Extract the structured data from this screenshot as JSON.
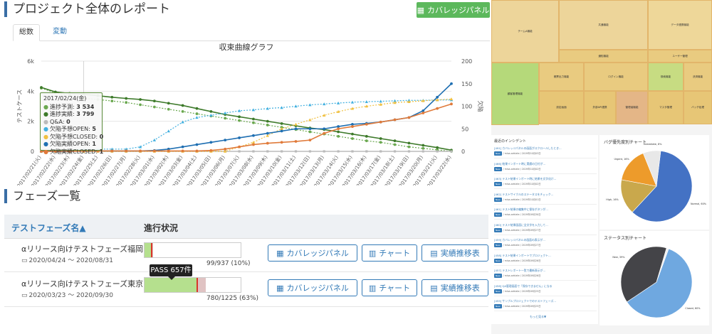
{
  "header": {
    "title": "プロジェクト全体のレポート",
    "coverage_button": "カバレッジパネル"
  },
  "tabs": [
    {
      "label": "総数",
      "active": true
    },
    {
      "label": "変動",
      "active": false
    }
  ],
  "chart_data": {
    "type": "line",
    "title": "収束曲線グラフ",
    "ylabel": "テストケース",
    "y2label": "欠陥",
    "ylim": [
      0,
      6000
    ],
    "y2lim": [
      0,
      200
    ],
    "yticks": [
      "0",
      "2k",
      "4k",
      "6k"
    ],
    "y2ticks": [
      "0",
      "50",
      "100",
      "150",
      "200"
    ],
    "x": [
      "2017/02/21(火)",
      "2017/02/22(水)",
      "2017/02/23(木)",
      "2017/02/24(金)",
      "2017/02/25(土)",
      "2017/02/26(日)",
      "2017/02/27(月)",
      "2017/02/28(火)",
      "2017/03/01(水)",
      "2017/03/02(木)",
      "2017/03/03(金)",
      "2017/03/04(土)",
      "2017/03/05(日)",
      "2017/03/06(月)",
      "2017/03/07(火)",
      "2017/03/08(水)",
      "2017/03/09(木)",
      "2017/03/10(金)",
      "2017/03/11(土)",
      "2017/03/12(日)",
      "2017/03/13(月)",
      "2017/03/14(火)",
      "2017/03/15(水)",
      "2017/03/16(木)",
      "2017/03/17(金)",
      "2017/03/18(土)",
      "2017/03/19(日)",
      "2017/03/20(月)",
      "2017/03/21(火)",
      "2017/03/22(水)"
    ],
    "series": [
      {
        "name": "進捗予測",
        "axis": "left",
        "color": "#6aa84f",
        "dash": "2,2",
        "marker": "circle",
        "values": [
          4200,
          3900,
          3700,
          3534,
          3450,
          3350,
          3250,
          3100,
          2950,
          2800,
          2650,
          2500,
          2350,
          2200,
          2050,
          1900,
          1750,
          1600,
          1450,
          1300,
          1150,
          1000,
          850,
          700,
          600,
          450,
          300,
          200,
          100,
          0
        ]
      },
      {
        "name": "進捗実績",
        "axis": "left",
        "color": "#3d7a2a",
        "dash": "",
        "marker": "circle",
        "values": [
          4250,
          3950,
          3850,
          3799,
          3700,
          3600,
          3520,
          3450,
          3350,
          3200,
          3050,
          2850,
          2650,
          2450,
          2300,
          2150,
          2000,
          1850,
          1700,
          1550,
          1450,
          1300,
          1150,
          1000,
          850,
          700,
          550,
          400,
          250,
          80
        ]
      },
      {
        "name": "Q&A",
        "axis": "right",
        "color": "#bbbbbb",
        "dash": "",
        "marker": "square",
        "values": [
          0,
          0,
          0,
          0,
          0,
          0,
          0,
          0,
          0,
          0,
          0,
          0,
          0,
          0,
          0,
          0,
          0,
          0,
          0,
          0,
          0,
          0,
          0,
          0,
          0,
          0,
          0,
          0,
          0,
          0
        ]
      },
      {
        "name": "欠陥予想OPEN",
        "axis": "right",
        "color": "#42b0e0",
        "dash": "2,2",
        "marker": "triangle",
        "values": [
          0,
          0,
          0,
          5,
          5,
          5,
          5,
          10,
          25,
          45,
          65,
          75,
          80,
          85,
          90,
          92,
          95,
          97,
          100,
          103,
          105,
          107,
          109,
          110,
          111,
          112,
          113,
          113,
          114,
          114
        ]
      },
      {
        "name": "欠陥予想CLOSED",
        "axis": "right",
        "color": "#f0c040",
        "dash": "2,2",
        "marker": "triangle",
        "values": [
          0,
          0,
          0,
          0,
          0,
          0,
          0,
          0,
          0,
          0,
          0,
          0,
          0,
          0,
          10,
          20,
          35,
          50,
          60,
          70,
          80,
          88,
          95,
          100,
          104,
          108,
          110,
          112,
          114,
          116
        ]
      },
      {
        "name": "欠陥実績OPEN",
        "axis": "right",
        "color": "#1f6fb2",
        "dash": "",
        "marker": "circle",
        "values": [
          0,
          0,
          0,
          1,
          1,
          1,
          1,
          1,
          2,
          5,
          10,
          15,
          20,
          25,
          30,
          35,
          40,
          45,
          50,
          50,
          50,
          55,
          60,
          62,
          65,
          70,
          75,
          90,
          120,
          150
        ]
      },
      {
        "name": "欠陥実績CLOSED",
        "axis": "right",
        "color": "#e07a3a",
        "dash": "",
        "marker": "circle",
        "values": [
          0,
          0,
          0,
          1,
          1,
          1,
          1,
          1,
          1,
          1,
          1,
          1,
          2,
          5,
          10,
          15,
          18,
          20,
          22,
          25,
          40,
          50,
          55,
          60,
          65,
          70,
          75,
          85,
          95,
          105
        ]
      }
    ],
    "tooltip": {
      "date": "2017/02/24(金)",
      "rows": [
        {
          "name": "進捗予測",
          "value": "3 534"
        },
        {
          "name": "進捗実績",
          "value": "3 799"
        },
        {
          "name": "Q&A",
          "value": "0"
        },
        {
          "name": "欠陥予想OPEN",
          "value": "5"
        },
        {
          "name": "欠陥予想CLOSED",
          "value": "0"
        },
        {
          "name": "欠陥実績OPEN",
          "value": "1"
        },
        {
          "name": "欠陥実績CLOSED",
          "value": "1"
        }
      ]
    }
  },
  "phases": {
    "title": "フェーズ一覧",
    "col_name": "テストフェーズ名▲",
    "col_progress": "進行状況",
    "rows": [
      {
        "name": "αリリース向けテストフェーズ福岡",
        "date": "2020/04/24 〜 2020/08/31",
        "count": "99/937 (10%)",
        "pass_fraction": 0.07,
        "fail_fraction": 0.02
      },
      {
        "name": "αリリース向けテストフェーズ東京",
        "date": "2020/03/23 〜 2020/09/30",
        "count": "780/1225 (63%)",
        "pass_fraction": 0.54,
        "fail_fraction": 0.1
      }
    ],
    "pass_tip": "PASS 657件",
    "buttons": {
      "coverage": "カバレッジパネル",
      "chart": "チャート",
      "history": "実績推移表"
    }
  },
  "treemap": {
    "cells": [
      "チームA機能",
      "共通機能",
      "データ連携機能",
      "顧客管理機能",
      "帳票出力機能",
      "ログイン機能",
      "検索機能",
      "決済機能",
      "通知機能",
      "ユーザー管理",
      "設定画面",
      "外部API連携",
      "管理者機能",
      "マスタ管理",
      "バッチ処理",
      "セキュリティ",
      "レポート機能"
    ]
  },
  "incidents": {
    "title": "最近のインシデント",
    "more": "もっと見る▼",
    "items": [
      {
        "text": "[491] カバレッジパネルの画面がスクロールしたとき…",
        "meta": "/ misa-sekiate / 2019年10月03日"
      },
      {
        "text": "[466] 結果インポート時に実績の日付が…",
        "meta": "/ misa-sekiate / 2019年10月02日"
      },
      {
        "text": "[463] テスト結果インポート時に結果を文字化け…",
        "meta": "/ misa-sekiate / 2019年10月02日"
      },
      {
        "text": "[462] テストサイクルのステータスをチェック…",
        "meta": "/ misa-sekiate / 2019年10月01日"
      },
      {
        "text": "[461] テスト結果の編集中に保存ボタンが…",
        "meta": "/ misa-sekiate / 2019年09月30日"
      },
      {
        "text": "[460] テスト結果画面に全文字を入力して…",
        "meta": "/ misa-sekiate / 2019年09月27日"
      },
      {
        "text": "[459] カバレッジパネルの画面の表示が…",
        "meta": "/ misa-sekiate / 2019年09月27日"
      },
      {
        "text": "[458] テスト結果インポートでプロジェクト…",
        "meta": "/ misa-sekiate / 2019年09月26日"
      },
      {
        "text": "[457] テストレポート一覧で最新表示が…",
        "meta": "/ misa-sekiate / 2019年09月26日"
      },
      {
        "text": "[456] QA管理画面で「保存できません」になる",
        "meta": "/ misa-sekiate / 2019年09月25日"
      },
      {
        "text": "[455] サンプルプロジェクトでのテストフェーズ…",
        "meta": "/ misa-sekiate / 2019年09月25日"
      }
    ]
  },
  "pies": [
    {
      "title": "バグ優先度別チャート",
      "slices": [
        {
          "name": "Normal",
          "label": "Normal, 60%",
          "value": 60,
          "color": "#4472c4"
        },
        {
          "name": "High",
          "label": "High, 16%",
          "value": 16,
          "color": "#c9a84c"
        },
        {
          "name": "Urgent",
          "label": "Urgent, 16%",
          "value": 16,
          "color": "#ed9b2b"
        },
        {
          "name": "Immediate",
          "label": "Immediate, 8%",
          "value": 8,
          "color": "#e8e8e8"
        }
      ]
    },
    {
      "title": "ステータス別チャート",
      "slices": [
        {
          "name": "Closed",
          "label": "Closed, 60%",
          "value": 60,
          "color": "#6fa8e0"
        },
        {
          "name": "New",
          "label": "New, 39%",
          "value": 39,
          "color": "#444448"
        },
        {
          "name": "Other",
          "label": "",
          "value": 1,
          "color": "#f0f0f0"
        }
      ]
    }
  ]
}
